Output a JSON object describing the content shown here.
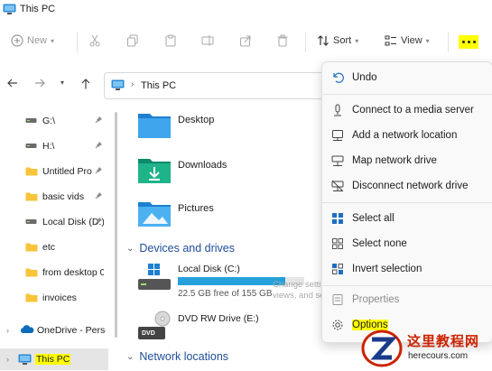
{
  "window": {
    "title": "This PC"
  },
  "toolbar": {
    "new_label": "New",
    "sort_label": "Sort",
    "view_label": "View"
  },
  "address": {
    "path": "This PC"
  },
  "sidebar": {
    "items": [
      {
        "label": "G:\\",
        "icon": "drive-icon",
        "pinned": true
      },
      {
        "label": "H:\\",
        "icon": "drive-icon",
        "pinned": true
      },
      {
        "label": "Untitled Pro",
        "icon": "folder-icon",
        "pinned": true
      },
      {
        "label": "basic vids",
        "icon": "folder-icon",
        "pinned": true
      },
      {
        "label": "Local Disk (D:)",
        "icon": "drive-icon",
        "pinned": true
      },
      {
        "label": "etc",
        "icon": "folder-icon",
        "pinned": false
      },
      {
        "label": "from desktop 0",
        "icon": "folder-icon",
        "pinned": false
      },
      {
        "label": "invoices",
        "icon": "folder-icon",
        "pinned": false
      },
      {
        "label": "OneDrive - Perso",
        "icon": "onedrive-icon",
        "pinned": false
      },
      {
        "label": "This PC",
        "icon": "pc-icon",
        "pinned": false,
        "selected": true
      }
    ]
  },
  "main": {
    "folders": [
      {
        "name": "Desktop",
        "icon": "desktop-folder-icon"
      },
      {
        "name": "Downloads",
        "icon": "downloads-folder-icon"
      },
      {
        "name": "Pictures",
        "icon": "pictures-folder-icon"
      }
    ],
    "devices_header": "Devices and drives",
    "drives": [
      {
        "name": "Local Disk (C:)",
        "free": "22.5 GB free of 155 GB",
        "used_fraction": 0.85
      },
      {
        "name": "DVD RW Drive (E:)",
        "badge": "DVD"
      }
    ],
    "network_header": "Network locations"
  },
  "menu": {
    "items": [
      {
        "label": "Undo",
        "icon": "undo-icon"
      },
      {
        "label": "Connect to a media server",
        "icon": "media-server-icon"
      },
      {
        "label": "Add a network location",
        "icon": "network-location-icon"
      },
      {
        "label": "Map network drive",
        "icon": "map-drive-icon"
      },
      {
        "label": "Disconnect network drive",
        "icon": "disconnect-drive-icon"
      },
      {
        "label": "Select all",
        "icon": "select-all-icon"
      },
      {
        "label": "Select none",
        "icon": "select-none-icon"
      },
      {
        "label": "Invert selection",
        "icon": "invert-selection-icon"
      },
      {
        "label": "Properties",
        "icon": "properties-icon"
      },
      {
        "label": "Options",
        "icon": "options-icon"
      }
    ]
  },
  "tooltip": {
    "line1": "Change settings for opening items, file and folder",
    "line2": "views, and search."
  },
  "watermark": {
    "title": "这里教程网",
    "url": "herecours.com"
  },
  "colors": {
    "accent": "#26a0da",
    "highlight": "#ffff00",
    "link_blue": "#1f4e9a"
  }
}
